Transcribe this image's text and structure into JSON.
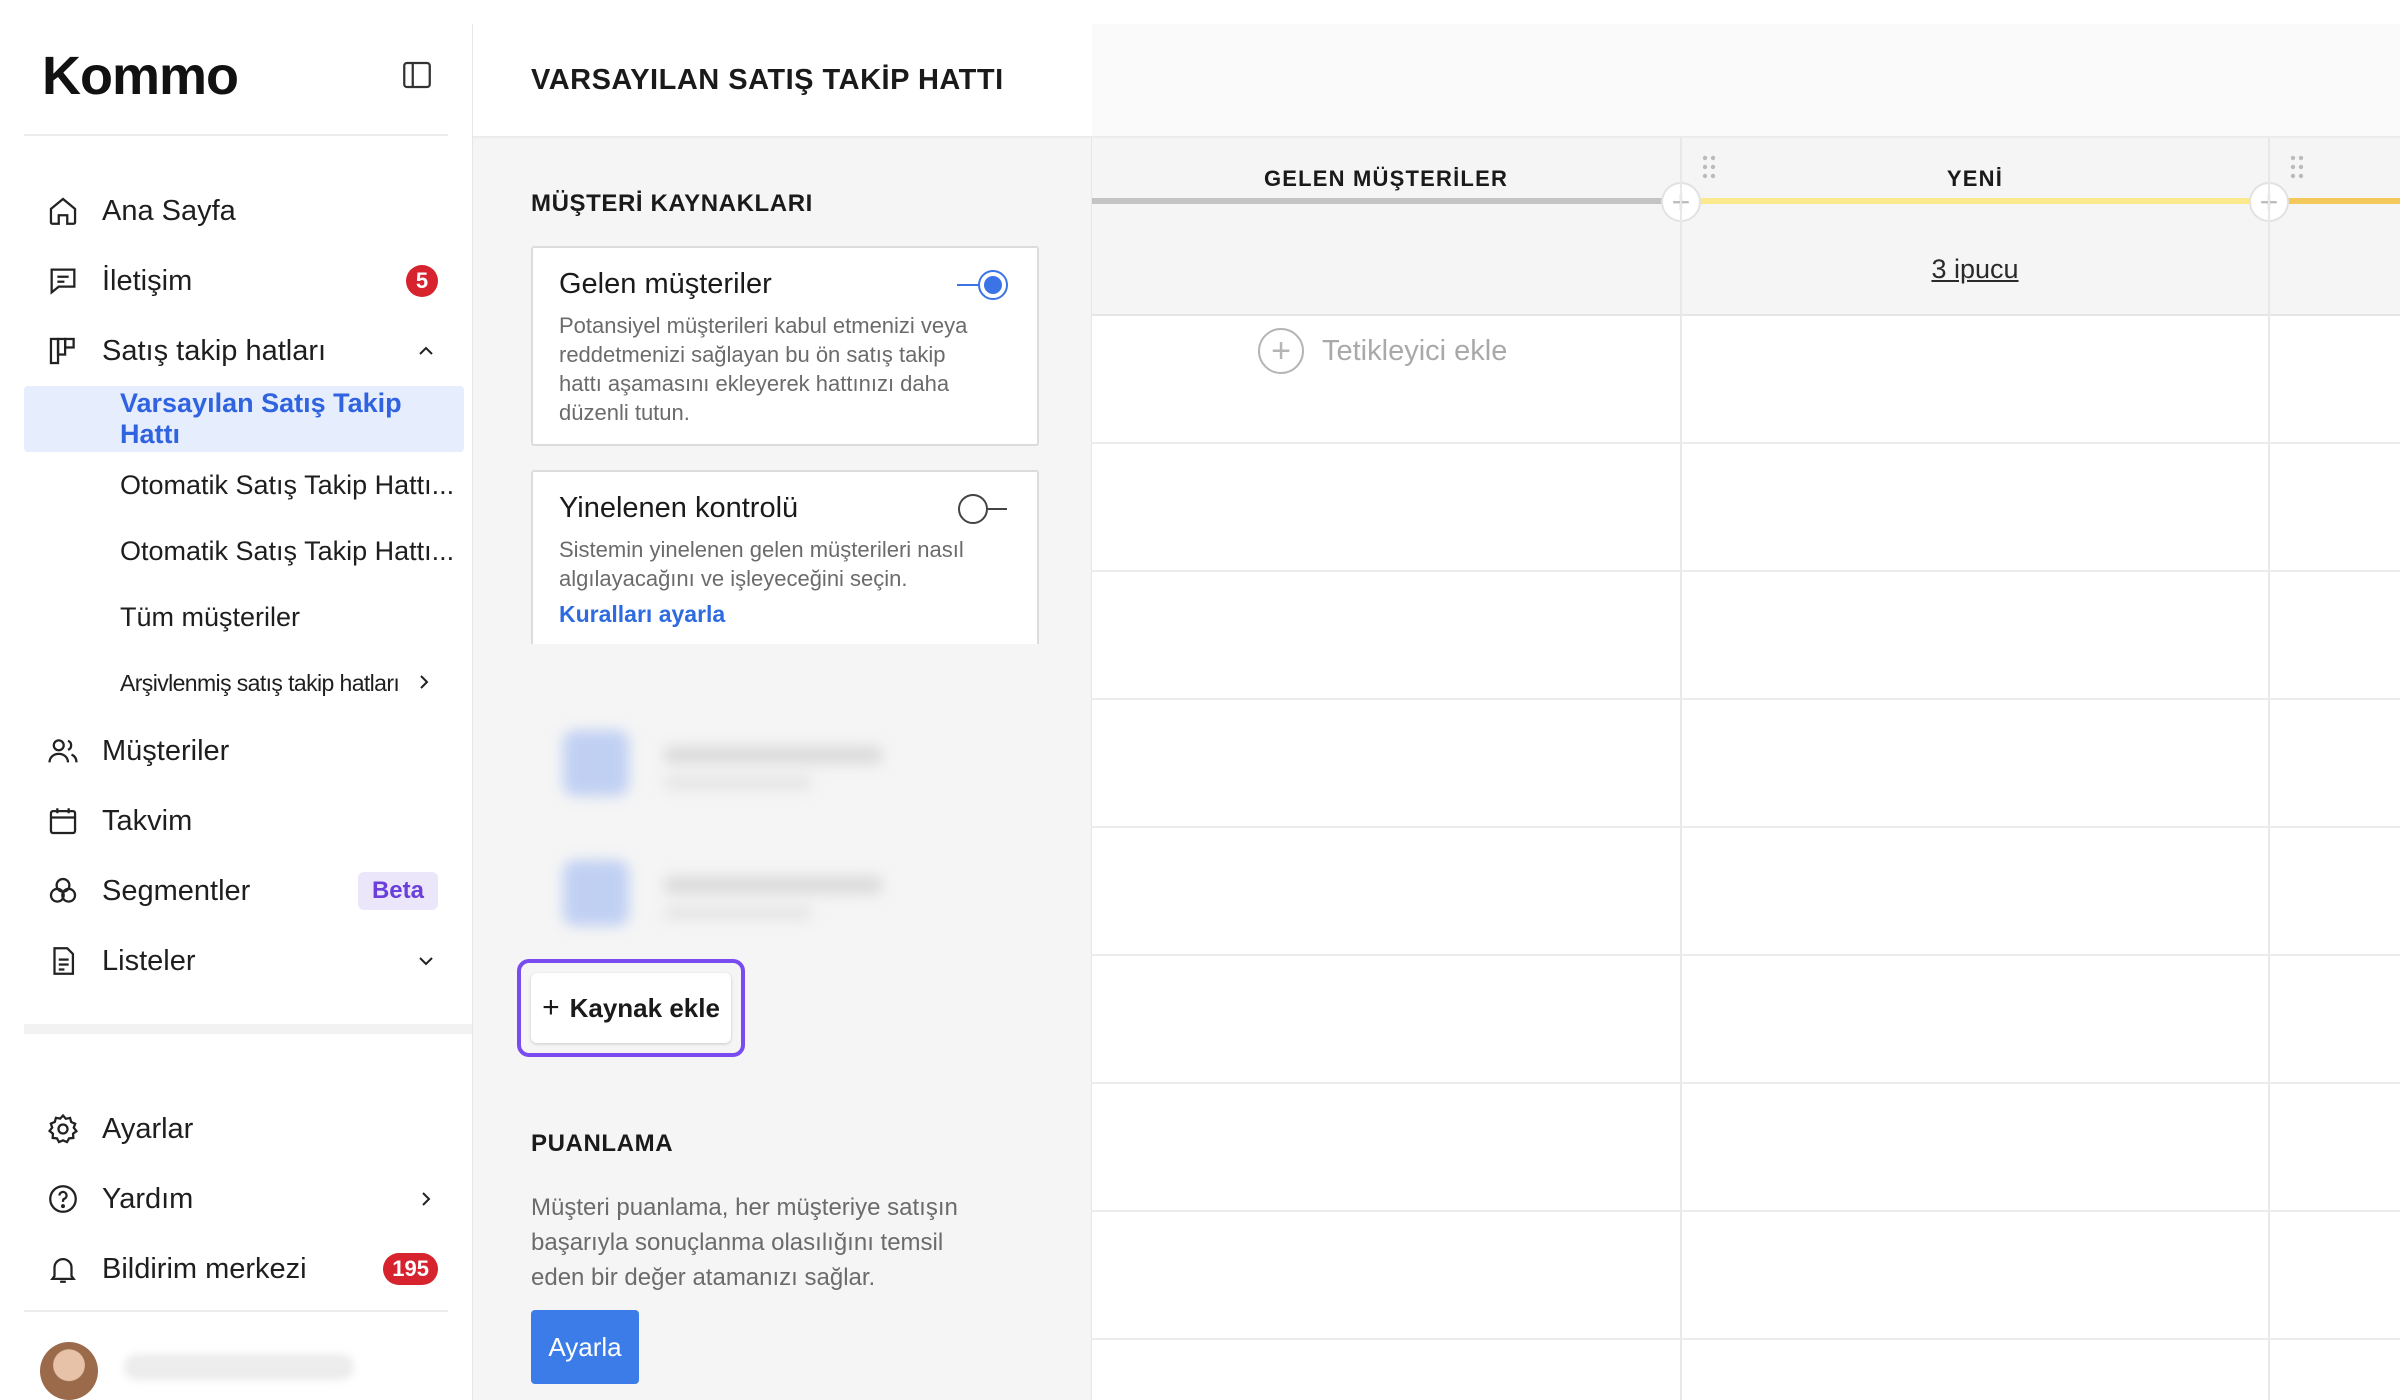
{
  "brand": {
    "logo_text": "Kommo"
  },
  "sidebar": {
    "items": [
      {
        "label": "Ana Sayfa",
        "icon": "home-icon"
      },
      {
        "label": "İletişim",
        "icon": "chat-icon",
        "badge": "5"
      },
      {
        "label": "Satış takip hatları",
        "icon": "pipeline-icon"
      },
      {
        "label": "Müşteriler",
        "icon": "users-icon"
      },
      {
        "label": "Takvim",
        "icon": "calendar-icon"
      },
      {
        "label": "Segmentler",
        "icon": "segments-icon",
        "badge": "Beta"
      },
      {
        "label": "Listeler",
        "icon": "list-icon"
      }
    ],
    "pipelines": [
      {
        "label": "Varsayılan Satış Takip Hattı"
      },
      {
        "label": "Otomatik Satış Takip Hattı..."
      },
      {
        "label": "Otomatik Satış Takip Hattı..."
      },
      {
        "label": "Tüm müşteriler"
      },
      {
        "label": "Arşivlenmiş satış takip hatları"
      }
    ],
    "bottom": [
      {
        "label": "Ayarlar",
        "icon": "gear-icon"
      },
      {
        "label": "Yardım",
        "icon": "help-icon"
      },
      {
        "label": "Bildirim merkezi",
        "icon": "bell-icon",
        "badge": "195"
      }
    ]
  },
  "panel": {
    "title": "VARSAYILAN SATIŞ TAKİP HATTI",
    "sources_title": "MÜŞTERİ KAYNAKLARI",
    "cards": [
      {
        "title": "Gelen müşteriler",
        "desc": "Potansiyel müşterileri kabul etmenizi veya reddetmenizi sağlayan bu ön satış takip hattı aşamasını ekleyerek hattınızı daha düzenli tutun.",
        "enabled": true
      },
      {
        "title": "Yinelenen kontrolü",
        "desc": "Sistemin yinelenen gelen müşterileri nasıl algılayacağını ve işleyeceğini seçin.",
        "link": "Kuralları ayarla",
        "enabled": false
      }
    ],
    "add_source_label": "Kaynak ekle",
    "scoring_title": "PUANLAMA",
    "scoring_desc": "Müşteri puanlama, her müşteriye satışın başarıyla sonuçlanma olasılığını temsil eden bir değer atamanızı sağlar.",
    "setup_label": "Ayarla"
  },
  "board": {
    "columns": [
      {
        "title": "GELEN MÜŞTERİLER",
        "color": "#c4c4c4"
      },
      {
        "title": "YENİ",
        "color": "#fbe98d",
        "tips": "3 ipucu"
      }
    ],
    "add_trigger_label": "Tetikleyici ekle"
  },
  "colors": {
    "accent": "#2f63e0",
    "highlight": "#7a4cf0",
    "badge": "#d6232d"
  }
}
